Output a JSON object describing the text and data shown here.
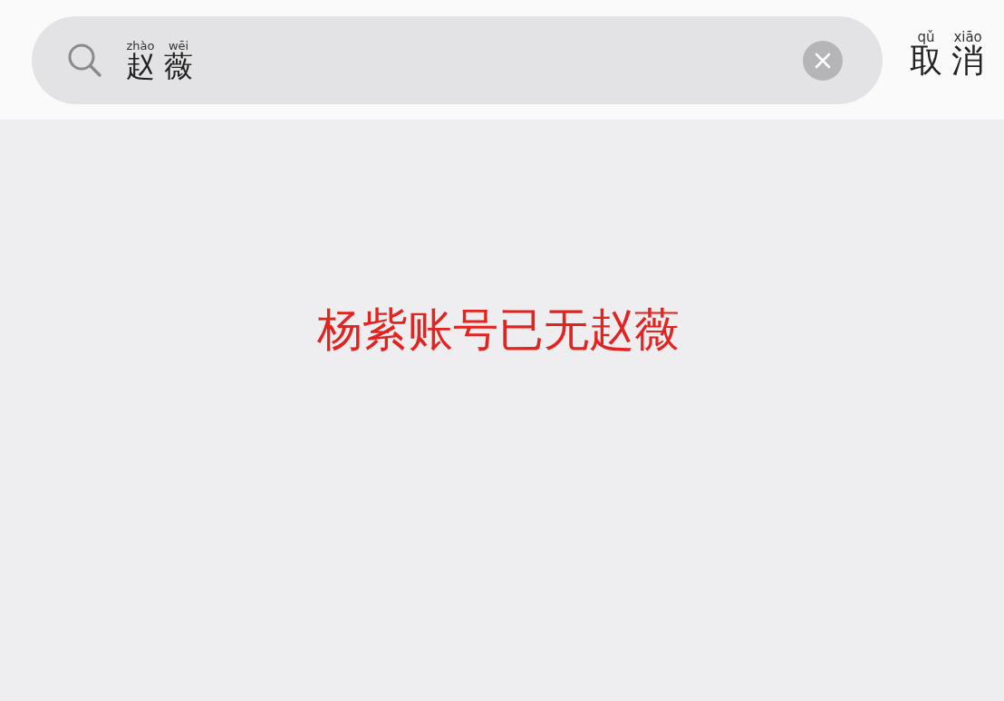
{
  "search": {
    "query": [
      {
        "char": "赵",
        "pinyin": "zhào"
      },
      {
        "char": "薇",
        "pinyin": "wēi"
      }
    ]
  },
  "cancel": [
    {
      "char": "取",
      "pinyin": "qǔ"
    },
    {
      "char": "消",
      "pinyin": "xiāo"
    }
  ],
  "message": "杨紫账号已无赵薇"
}
